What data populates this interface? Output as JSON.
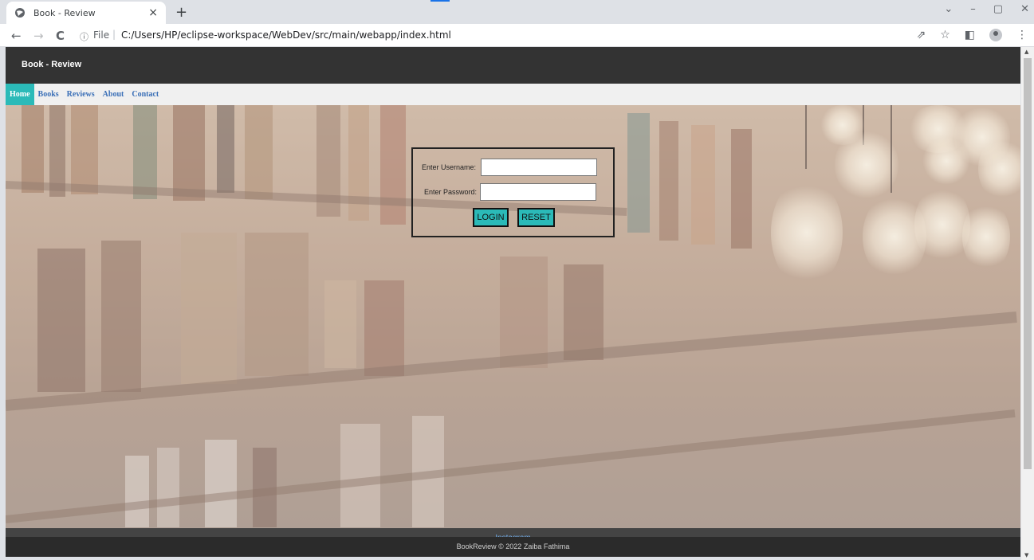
{
  "browser": {
    "tab_title": "Book - Review",
    "tab_close": "×",
    "new_tab": "+",
    "back": "←",
    "forward": "→",
    "reload": "C",
    "info": "ⓘ",
    "url_scheme": "File",
    "url_separator": "|",
    "url": "C:/Users/HP/eclipse-workspace/WebDev/src/main/webapp/index.html",
    "window_controls": [
      "⌄",
      "–",
      "▢",
      "✕"
    ],
    "right_icons": [
      "⇗",
      "☆",
      "◧",
      "⋮"
    ]
  },
  "site": {
    "brand": "Book - Review",
    "nav": [
      {
        "label": "Home",
        "active": true
      },
      {
        "label": "Books",
        "active": false
      },
      {
        "label": "Reviews",
        "active": false
      },
      {
        "label": "About",
        "active": false
      },
      {
        "label": "Contact",
        "active": false
      }
    ]
  },
  "login": {
    "username_label": "Enter Username:",
    "username_value": "",
    "password_label": "Enter Password:",
    "password_value": "",
    "login_button": "LOGIN",
    "reset_button": "RESET"
  },
  "footer": {
    "instagram": "Instagram",
    "copyright": "BookReview © 2022 Zaiba Fathima"
  },
  "colors": {
    "accent": "#2bbab8",
    "header": "#333333",
    "nav_link": "#3a6fb7"
  }
}
